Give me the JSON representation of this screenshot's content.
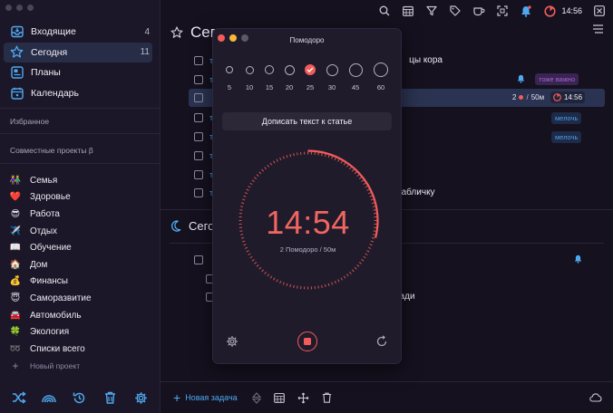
{
  "sidebar": {
    "nav": [
      {
        "label": "Входящие",
        "count": "4",
        "icon": "inbox-icon"
      },
      {
        "label": "Сегодня",
        "count": "11",
        "icon": "star-icon"
      },
      {
        "label": "Планы",
        "count": "",
        "icon": "plans-icon"
      },
      {
        "label": "Календарь",
        "count": "",
        "icon": "calendar-icon"
      }
    ],
    "favorites_label": "Избранное",
    "shared_label": "Совместные проекты β",
    "projects": [
      {
        "emoji": "👫",
        "label": "Семья"
      },
      {
        "emoji": "❤️",
        "label": "Здоровье"
      },
      {
        "emoji": "😎",
        "label": "Работа"
      },
      {
        "emoji": "✈️",
        "label": "Отдых"
      },
      {
        "emoji": "📖",
        "label": "Обучение"
      },
      {
        "emoji": "🏠",
        "label": "Дом"
      },
      {
        "emoji": "💰",
        "label": "Финансы"
      },
      {
        "emoji": "😇",
        "label": "Саморазвитие"
      },
      {
        "emoji": "🚘",
        "label": "Автомобиль"
      },
      {
        "emoji": "🍀",
        "label": "Экология"
      },
      {
        "emoji": "➿",
        "label": "Списки всего"
      }
    ],
    "new_project": "Новый проект"
  },
  "topbar": {
    "time": "14:56"
  },
  "main": {
    "header_title": "Сегодня",
    "section2_title": "Сегодня",
    "tasks": [
      {
        "prefix": "т",
        "text": "цы кора"
      },
      {
        "prefix": "т",
        "text": ""
      },
      {
        "prefix": "",
        "text": ""
      },
      {
        "prefix": "т",
        "text": ""
      },
      {
        "prefix": "т",
        "text": ""
      },
      {
        "prefix": "т",
        "text": ""
      },
      {
        "prefix": "т",
        "text": ""
      },
      {
        "prefix": "т",
        "text": "табличку"
      }
    ],
    "tasks2": [
      {
        "prefix": "",
        "text": ""
      },
      {
        "prefix": "",
        "text": ""
      },
      {
        "prefix": "",
        "text": "ради"
      }
    ],
    "tag_important": "тоже важно",
    "tag_minor": "мелочь",
    "pomo_count": "2",
    "pomo_duration": "50м",
    "task_time": "14:56",
    "new_task": "Новая задача"
  },
  "pomodoro": {
    "title": "Помодоро",
    "durations": [
      "5",
      "10",
      "15",
      "20",
      "25",
      "30",
      "45",
      "60"
    ],
    "selected_index": 4,
    "write_button": "Дописать текст к статье",
    "timer": "14:54",
    "subtitle": "2 Помодоро / 50м",
    "progress_fraction": 0.29
  },
  "colors": {
    "accent": "#f25c5a",
    "blue": "#4fa9f0",
    "purple": "#a066d8"
  }
}
